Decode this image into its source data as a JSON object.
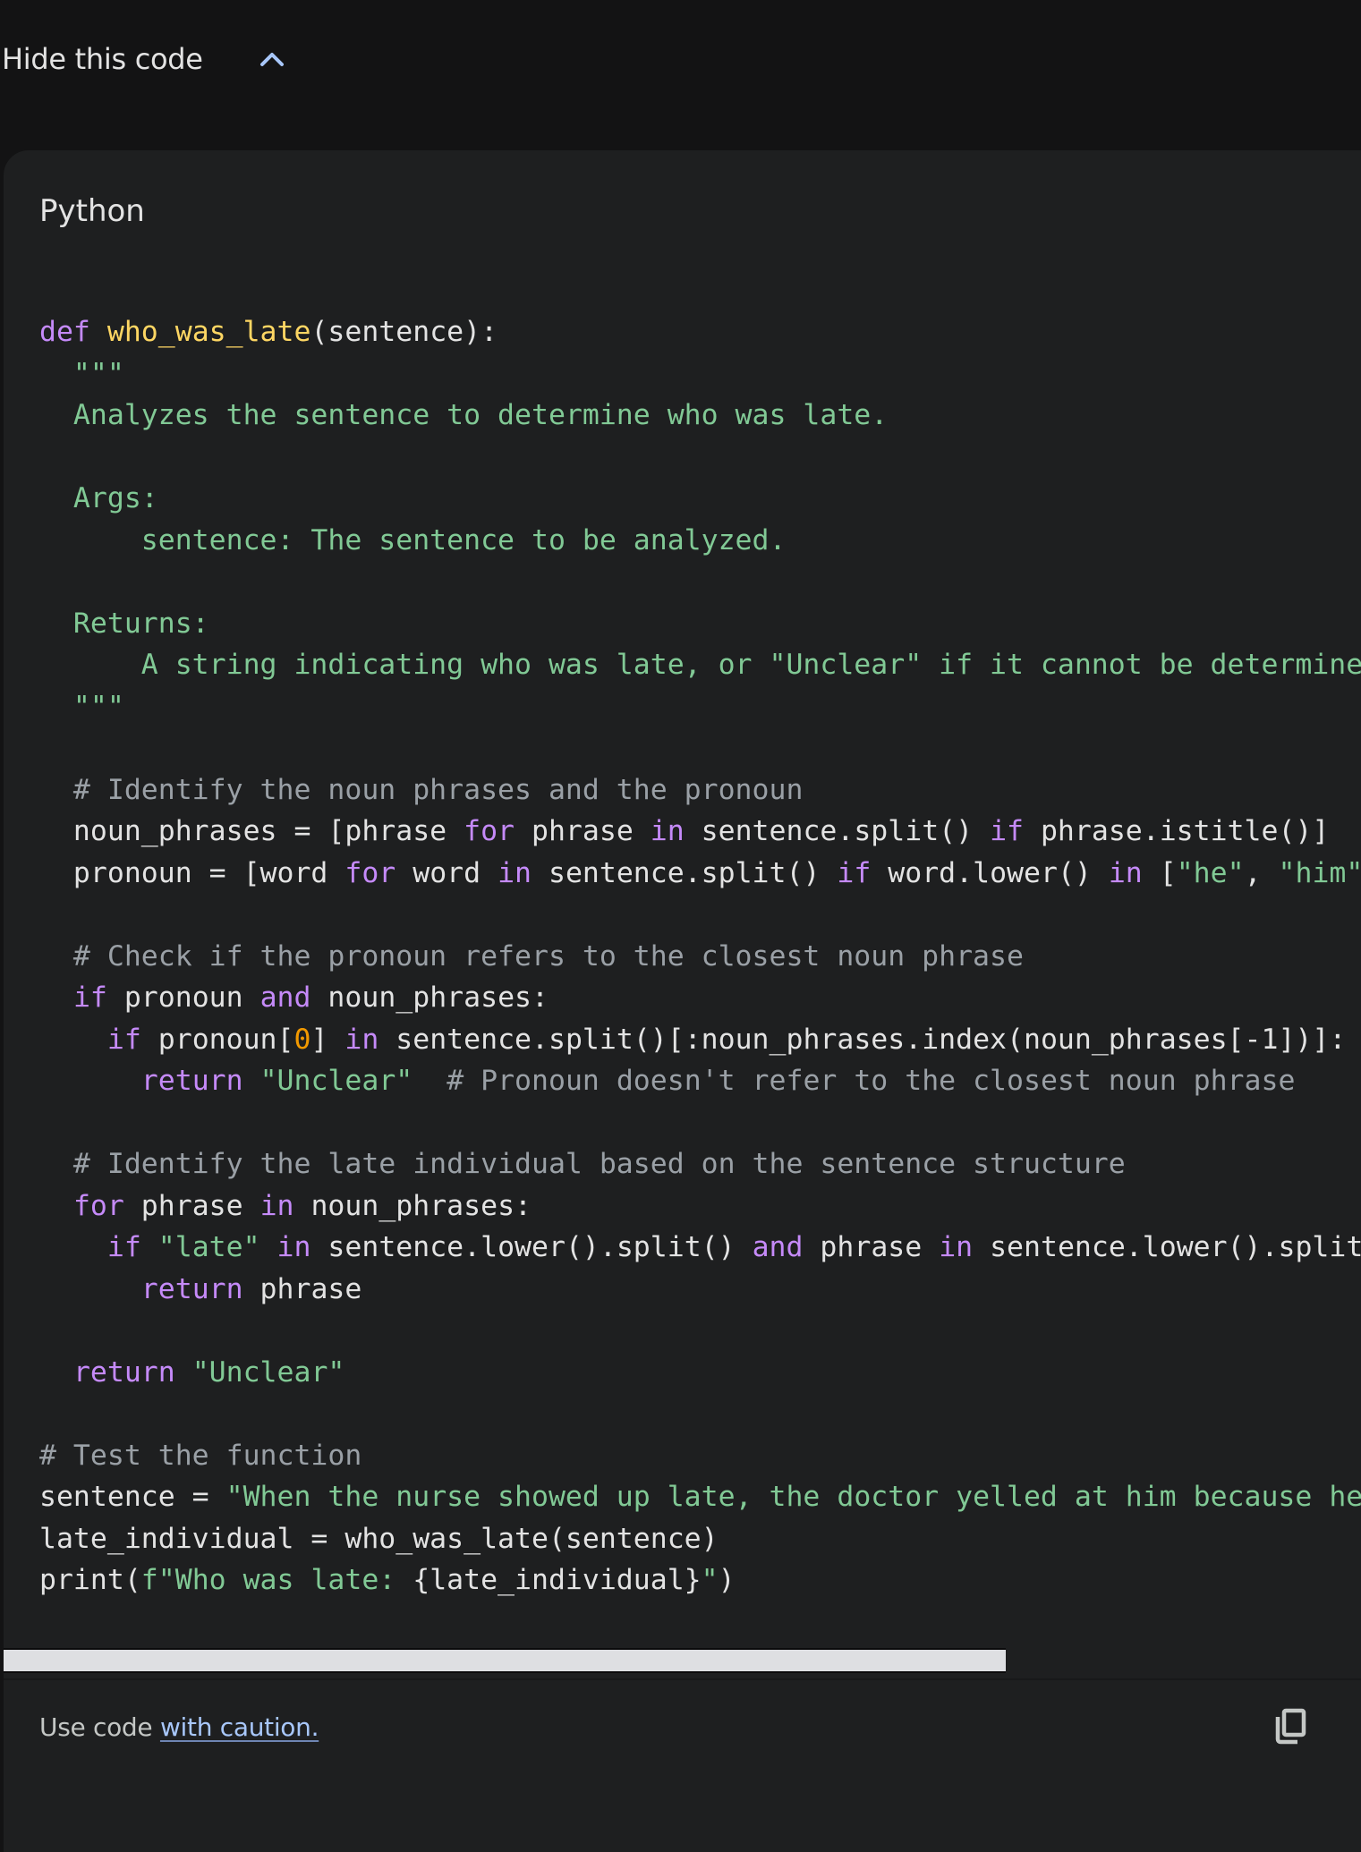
{
  "toggle": {
    "label": "Hide this code",
    "icon": "chevron-up-icon",
    "accent": "#a8c7fa"
  },
  "code_block": {
    "language": "Python",
    "colors": {
      "background": "#1e1f20",
      "keyword": "#c58af9",
      "function": "#fdd663",
      "string": "#81c995",
      "comment": "#9aa0a6",
      "number": "#f29900",
      "plain": "#e3e3e3"
    },
    "lines": [
      [
        {
          "t": "def",
          "c": "kw"
        },
        {
          "t": " "
        },
        {
          "t": "who_was_late",
          "c": "fn"
        },
        {
          "t": "(sentence):"
        }
      ],
      [
        {
          "t": "  \"\"\"",
          "c": "str"
        }
      ],
      [
        {
          "t": "  Analyzes the sentence to determine who was late.",
          "c": "str"
        }
      ],
      [
        {
          "t": ""
        }
      ],
      [
        {
          "t": "  Args:",
          "c": "str"
        }
      ],
      [
        {
          "t": "      sentence: The sentence to be analyzed.",
          "c": "str"
        }
      ],
      [
        {
          "t": ""
        }
      ],
      [
        {
          "t": "  Returns:",
          "c": "str"
        }
      ],
      [
        {
          "t": "      A string indicating who was late, or \"Unclear\" if it cannot be determined.",
          "c": "str"
        }
      ],
      [
        {
          "t": "  \"\"\"",
          "c": "str"
        }
      ],
      [
        {
          "t": ""
        }
      ],
      [
        {
          "t": "  # Identify the noun phrases and the pronoun",
          "c": "cm"
        }
      ],
      [
        {
          "t": "  noun_phrases = [phrase "
        },
        {
          "t": "for",
          "c": "kw"
        },
        {
          "t": " phrase "
        },
        {
          "t": "in",
          "c": "kw"
        },
        {
          "t": " sentence.split() "
        },
        {
          "t": "if",
          "c": "kw"
        },
        {
          "t": " phrase.istitle()]"
        }
      ],
      [
        {
          "t": "  pronoun = [word "
        },
        {
          "t": "for",
          "c": "kw"
        },
        {
          "t": " word "
        },
        {
          "t": "in",
          "c": "kw"
        },
        {
          "t": " sentence.split() "
        },
        {
          "t": "if",
          "c": "kw"
        },
        {
          "t": " word.lower() "
        },
        {
          "t": "in",
          "c": "kw"
        },
        {
          "t": " ["
        },
        {
          "t": "\"he\"",
          "c": "str"
        },
        {
          "t": ", "
        },
        {
          "t": "\"him\"",
          "c": "str"
        },
        {
          "t": "]]"
        }
      ],
      [
        {
          "t": ""
        }
      ],
      [
        {
          "t": "  # Check if the pronoun refers to the closest noun phrase",
          "c": "cm"
        }
      ],
      [
        {
          "t": "  "
        },
        {
          "t": "if",
          "c": "kw"
        },
        {
          "t": " pronoun "
        },
        {
          "t": "and",
          "c": "kw"
        },
        {
          "t": " noun_phrases:"
        }
      ],
      [
        {
          "t": "    "
        },
        {
          "t": "if",
          "c": "kw"
        },
        {
          "t": " pronoun["
        },
        {
          "t": "0",
          "c": "num"
        },
        {
          "t": "] "
        },
        {
          "t": "in",
          "c": "kw"
        },
        {
          "t": " sentence.split()[:noun_phrases.index(noun_phrases[-1])]:"
        }
      ],
      [
        {
          "t": "      "
        },
        {
          "t": "return",
          "c": "kw"
        },
        {
          "t": " "
        },
        {
          "t": "\"Unclear\"",
          "c": "str"
        },
        {
          "t": "  "
        },
        {
          "t": "# Pronoun doesn't refer to the closest noun phrase",
          "c": "cm"
        }
      ],
      [
        {
          "t": ""
        }
      ],
      [
        {
          "t": "  # Identify the late individual based on the sentence structure",
          "c": "cm"
        }
      ],
      [
        {
          "t": "  "
        },
        {
          "t": "for",
          "c": "kw"
        },
        {
          "t": " phrase "
        },
        {
          "t": "in",
          "c": "kw"
        },
        {
          "t": " noun_phrases:"
        }
      ],
      [
        {
          "t": "    "
        },
        {
          "t": "if",
          "c": "kw"
        },
        {
          "t": " "
        },
        {
          "t": "\"late\"",
          "c": "str"
        },
        {
          "t": " "
        },
        {
          "t": "in",
          "c": "kw"
        },
        {
          "t": " sentence.lower().split() "
        },
        {
          "t": "and",
          "c": "kw"
        },
        {
          "t": " phrase "
        },
        {
          "t": "in",
          "c": "kw"
        },
        {
          "t": " sentence.lower().split():"
        }
      ],
      [
        {
          "t": "      "
        },
        {
          "t": "return",
          "c": "kw"
        },
        {
          "t": " phrase"
        }
      ],
      [
        {
          "t": ""
        }
      ],
      [
        {
          "t": "  "
        },
        {
          "t": "return",
          "c": "kw"
        },
        {
          "t": " "
        },
        {
          "t": "\"Unclear\"",
          "c": "str"
        }
      ],
      [
        {
          "t": ""
        }
      ],
      [
        {
          "t": "# Test the function",
          "c": "cm"
        }
      ],
      [
        {
          "t": "sentence = "
        },
        {
          "t": "\"When the nurse showed up late, the doctor yelled at him because he was late.\"",
          "c": "str"
        }
      ],
      [
        {
          "t": "late_individual = who_was_late(sentence)"
        }
      ],
      [
        {
          "t": "print("
        },
        {
          "t": "f\"Who was late: ",
          "c": "str"
        },
        {
          "t": "{late_individual}"
        },
        {
          "t": "\"",
          "c": "str"
        },
        {
          "t": ")"
        }
      ]
    ],
    "horizontal_scroll_fraction": 0.0
  },
  "footer": {
    "prefix": "Use code ",
    "link": "with caution.",
    "copy_icon": "copy-icon"
  }
}
